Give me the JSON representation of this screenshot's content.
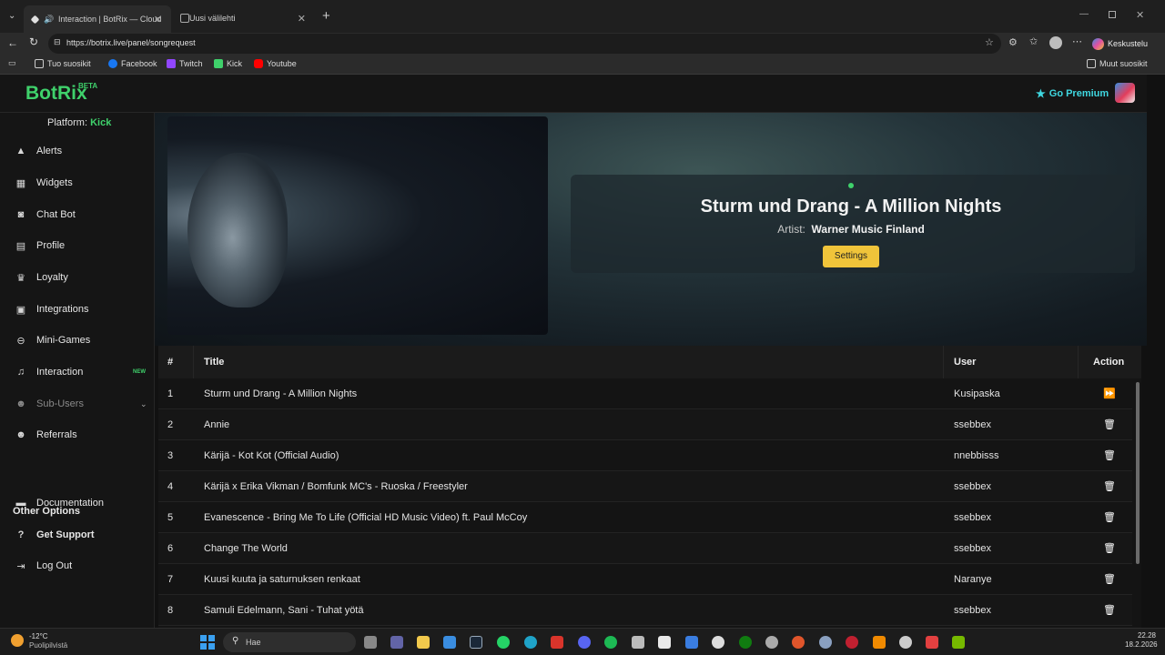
{
  "browser": {
    "tabs": [
      {
        "title": "Interaction | BotRix — Cloud",
        "active": true
      },
      {
        "title": "Uusi välilehti",
        "active": false
      }
    ],
    "url": "https://botrix.live/panel/songrequest",
    "profile_label": "Keskustelu",
    "bookmarks": [
      "Tuo suosikit",
      "Facebook",
      "Twitch",
      "Kick",
      "Youtube"
    ],
    "other_bookmarks": "Muut suosikit"
  },
  "app": {
    "logo": "BotRix",
    "beta": "BETA",
    "premium_label": "Go Premium",
    "platform_label": "Platform:",
    "platform_value": "Kick",
    "sidebar": {
      "items": [
        {
          "label": "Alerts",
          "icon": "warning-icon"
        },
        {
          "label": "Widgets",
          "icon": "widgets-icon"
        },
        {
          "label": "Chat Bot",
          "icon": "robot-icon"
        },
        {
          "label": "Profile",
          "icon": "id-card-icon"
        },
        {
          "label": "Loyalty",
          "icon": "trophy-icon"
        },
        {
          "label": "Integrations",
          "icon": "plug-icon"
        },
        {
          "label": "Mini-Games",
          "icon": "gamepad-icon"
        },
        {
          "label": "Interaction",
          "icon": "music-icon",
          "badge": "NEW"
        },
        {
          "label": "Sub-Users",
          "icon": "users-icon",
          "muted": true
        },
        {
          "label": "Referrals",
          "icon": "user-group-icon"
        }
      ],
      "other_options_heading": "Other Options",
      "other_items": [
        {
          "label": "Documentation",
          "icon": "book-icon"
        },
        {
          "label": "Get Support",
          "icon": "question-icon"
        },
        {
          "label": "Log Out",
          "icon": "logout-icon"
        }
      ]
    },
    "now_playing": {
      "title": "Sturm und Drang - A Million Nights",
      "artist_label": "Artist:",
      "artist": "Warner Music Finland",
      "settings_label": "Settings"
    },
    "queue": {
      "headers": [
        "#",
        "Title",
        "User",
        "Action"
      ],
      "rows": [
        {
          "n": "1",
          "title": "Sturm und Drang - A Million Nights",
          "user": "Kusipaska",
          "action": "skip"
        },
        {
          "n": "2",
          "title": "Annie",
          "user": "ssebbex",
          "action": "delete"
        },
        {
          "n": "3",
          "title": "Kärijä - Kot Kot (Official Audio)",
          "user": "nnebbisss",
          "action": "delete"
        },
        {
          "n": "4",
          "title": "Kärijä x Erika Vikman / Bomfunk MC's - Ruoska / Freestyler",
          "user": "ssebbex",
          "action": "delete"
        },
        {
          "n": "5",
          "title": "Evanescence - Bring Me To Life (Official HD Music Video) ft. Paul McCoy",
          "user": "ssebbex",
          "action": "delete"
        },
        {
          "n": "6",
          "title": "Change The World",
          "user": "ssebbex",
          "action": "delete"
        },
        {
          "n": "7",
          "title": "Kuusi kuuta ja saturnuksen renkaat",
          "user": "Naranye",
          "action": "delete"
        },
        {
          "n": "8",
          "title": "Samuli Edelmann, Sani - Tuhat yötä",
          "user": "ssebbex",
          "action": "delete"
        }
      ]
    }
  },
  "taskbar": {
    "temp": "-12°C",
    "weather": "Puolipilvistä",
    "search_placeholder": "Hae",
    "time": "22.28",
    "date": "18.2.2026"
  },
  "colors": {
    "accent": "#3fd16b",
    "premium": "#3fd7e0",
    "settings_button": "#f0c43a"
  }
}
